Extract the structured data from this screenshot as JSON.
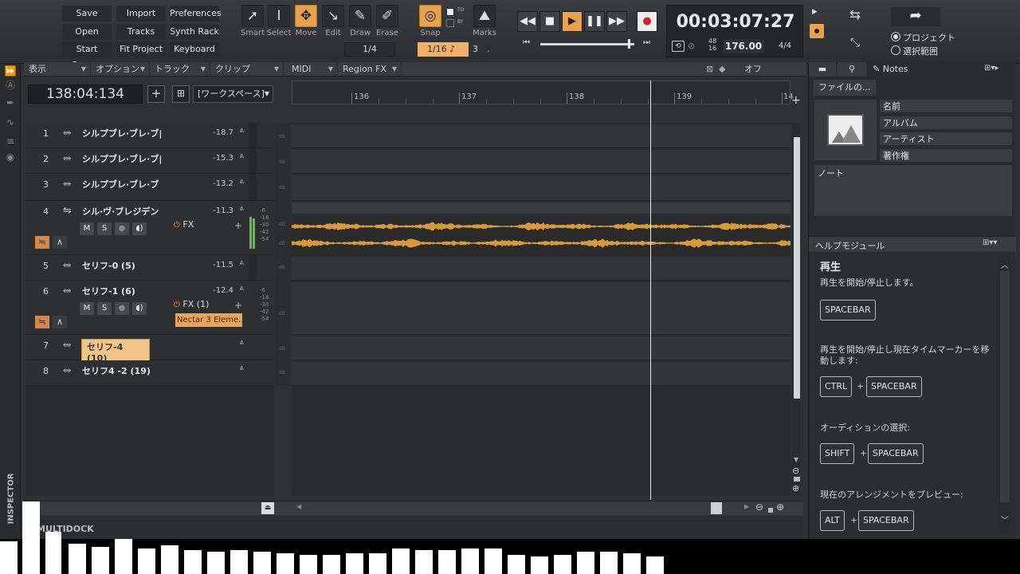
{
  "control_bar": {
    "file_buttons": [
      "Save",
      "Import",
      "Preferences",
      "Open",
      "Tracks",
      "Synth Rack",
      "Start Screen",
      "Fit Project",
      "Keyboard"
    ],
    "tools": [
      "Smart",
      "Select",
      "Move",
      "Edit",
      "Draw",
      "Erase"
    ],
    "snap": {
      "label": "Snap",
      "value": "1/16",
      "grid": "1/4",
      "to": "TO",
      "by": "BY",
      "count": "3",
      "dot": "."
    },
    "marks": "Marks",
    "time": "00:03:07:27",
    "tempo": "176.00",
    "meter": "4/4",
    "sample_rate": "48",
    "bit_depth": "16",
    "selection_options": [
      "プロジェクト",
      "選択範囲"
    ]
  },
  "menu": [
    "表示",
    "オプション",
    "トラック",
    "クリップ",
    "MIDI",
    "Region FX"
  ],
  "menu_right": "オフ",
  "now_time": "138:04:134",
  "workspace": "[ワークスペース]",
  "ruler": {
    "labels": [
      "136",
      "137",
      "138",
      "139",
      "14"
    ]
  },
  "tracks": [
    {
      "num": "1",
      "name": "シルプブレ·ブレ·ブ|",
      "vol": "-18.7"
    },
    {
      "num": "2",
      "name": "シルプブレ·ブレ·ブ|",
      "vol": "-15.3"
    },
    {
      "num": "3",
      "name": "シルプブレ·ブレ·ブ",
      "vol": "-13.2"
    },
    {
      "num": "4",
      "name": "シル·ヴ·ブレジデン",
      "vol": "-11.3",
      "fx": "FX"
    },
    {
      "num": "5",
      "name": "セリフ-0 (5)",
      "vol": "-11.5"
    },
    {
      "num": "6",
      "name": "セリフ-1 (6)",
      "vol": "-12.4",
      "fx": "FX (1)",
      "plugin": "Nectar 3 Eleme..."
    },
    {
      "num": "7",
      "name": "セリフ-4 (10)",
      "vol": ""
    },
    {
      "num": "8",
      "name": "セリフ4 -2 (19)",
      "vol": ""
    }
  ],
  "msb": [
    "M",
    "S"
  ],
  "meter_scale": [
    "-6",
    "-18",
    "-30",
    "-42",
    "-54"
  ],
  "db_label": "dB",
  "inspector": "INSPECTOR",
  "multidock": "MULTIDOCK",
  "right_pane": {
    "tabs": [
      "Notes"
    ],
    "file_button": "ファイルの...",
    "meta_fields": [
      "名前",
      "アルバム",
      "アーティスト",
      "著作権"
    ],
    "notes_label": "ノート",
    "help_title": "ヘルプモジュール",
    "help": {
      "heading": "再生",
      "intro": "再生を開始/停止します。",
      "k1": "SPACEBAR",
      "desc2": "再生を開始/停止し現在タイムマーカーを移動します:",
      "k2a": "CTRL",
      "k2b": "SPACEBAR",
      "desc3": "オーディションの選択:",
      "k3a": "SHIFT",
      "k3b": "SPACEBAR",
      "desc4": "現在のアレンジメントをプレビュー:",
      "k4a": "ALT",
      "k4b": "SPACEBAR",
      "plus": "+"
    }
  },
  "colors": {
    "accent": "#e9a24b",
    "waveform": "#d79a3a",
    "background": "#2f3032"
  }
}
